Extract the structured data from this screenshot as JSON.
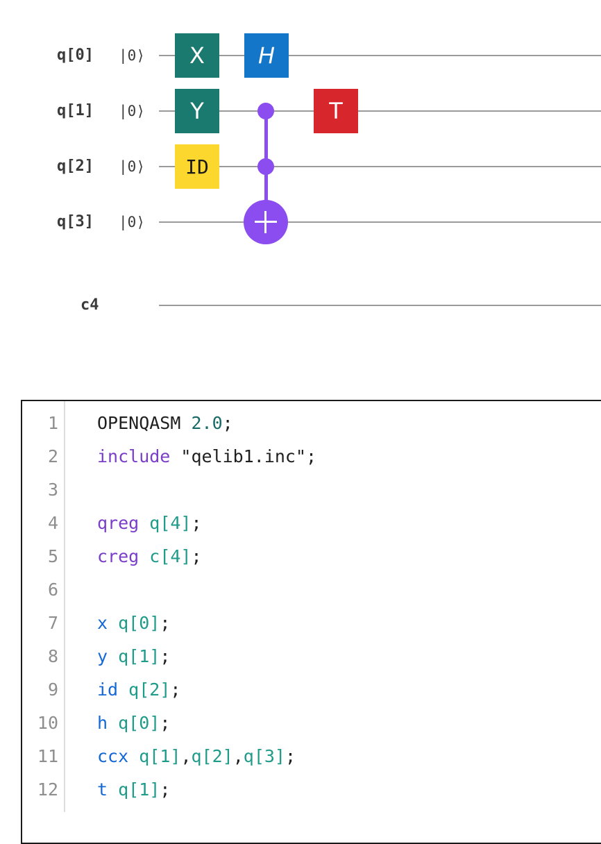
{
  "circuit": {
    "qubits": [
      {
        "label": "q[0]",
        "init": "|0⟩"
      },
      {
        "label": "q[1]",
        "init": "|0⟩"
      },
      {
        "label": "q[2]",
        "init": "|0⟩"
      },
      {
        "label": "q[3]",
        "init": "|0⟩"
      }
    ],
    "creg_label": "c4",
    "gates": {
      "x": "X",
      "y": "Y",
      "id": "ID",
      "h": "H",
      "t": "T"
    },
    "colors": {
      "pauli": "#1b7a6f",
      "hadamard": "#1376c8",
      "t_gate": "#d7262c",
      "identity": "#fcd72e",
      "multi_qubit": "#8b4cf0",
      "wire": "#9a9a9a"
    }
  },
  "editor": {
    "line_numbers": [
      "1",
      "2",
      "3",
      "4",
      "5",
      "6",
      "7",
      "8",
      "9",
      "10",
      "11",
      "12"
    ],
    "lines": {
      "l1": {
        "kw": "OPENQASM",
        "sp": " ",
        "num": "2.0",
        "end": ";"
      },
      "l2": {
        "kw": "include",
        "sp": " ",
        "str": "\"qelib1.inc\"",
        "end": ";"
      },
      "l4": {
        "kw": "qreg",
        "sp": " ",
        "arg": "q[4]",
        "end": ";"
      },
      "l5": {
        "kw": "creg",
        "sp": " ",
        "arg": "c[4]",
        "end": ";"
      },
      "l7": {
        "kw": "x",
        "sp": " ",
        "arg": "q[0]",
        "end": ";"
      },
      "l8": {
        "kw": "y",
        "sp": " ",
        "arg": "q[1]",
        "end": ";"
      },
      "l9": {
        "kw": "id",
        "sp": " ",
        "arg": "q[2]",
        "end": ";"
      },
      "l10": {
        "kw": "h",
        "sp": " ",
        "arg": "q[0]",
        "end": ";"
      },
      "l11": {
        "kw": "ccx",
        "sp": " ",
        "a1": "q[1]",
        "c1": ",",
        "a2": "q[2]",
        "c2": ",",
        "a3": "q[3]",
        "end": ";"
      },
      "l12": {
        "kw": "t",
        "sp": " ",
        "arg": "q[1]",
        "end": ";"
      }
    }
  }
}
